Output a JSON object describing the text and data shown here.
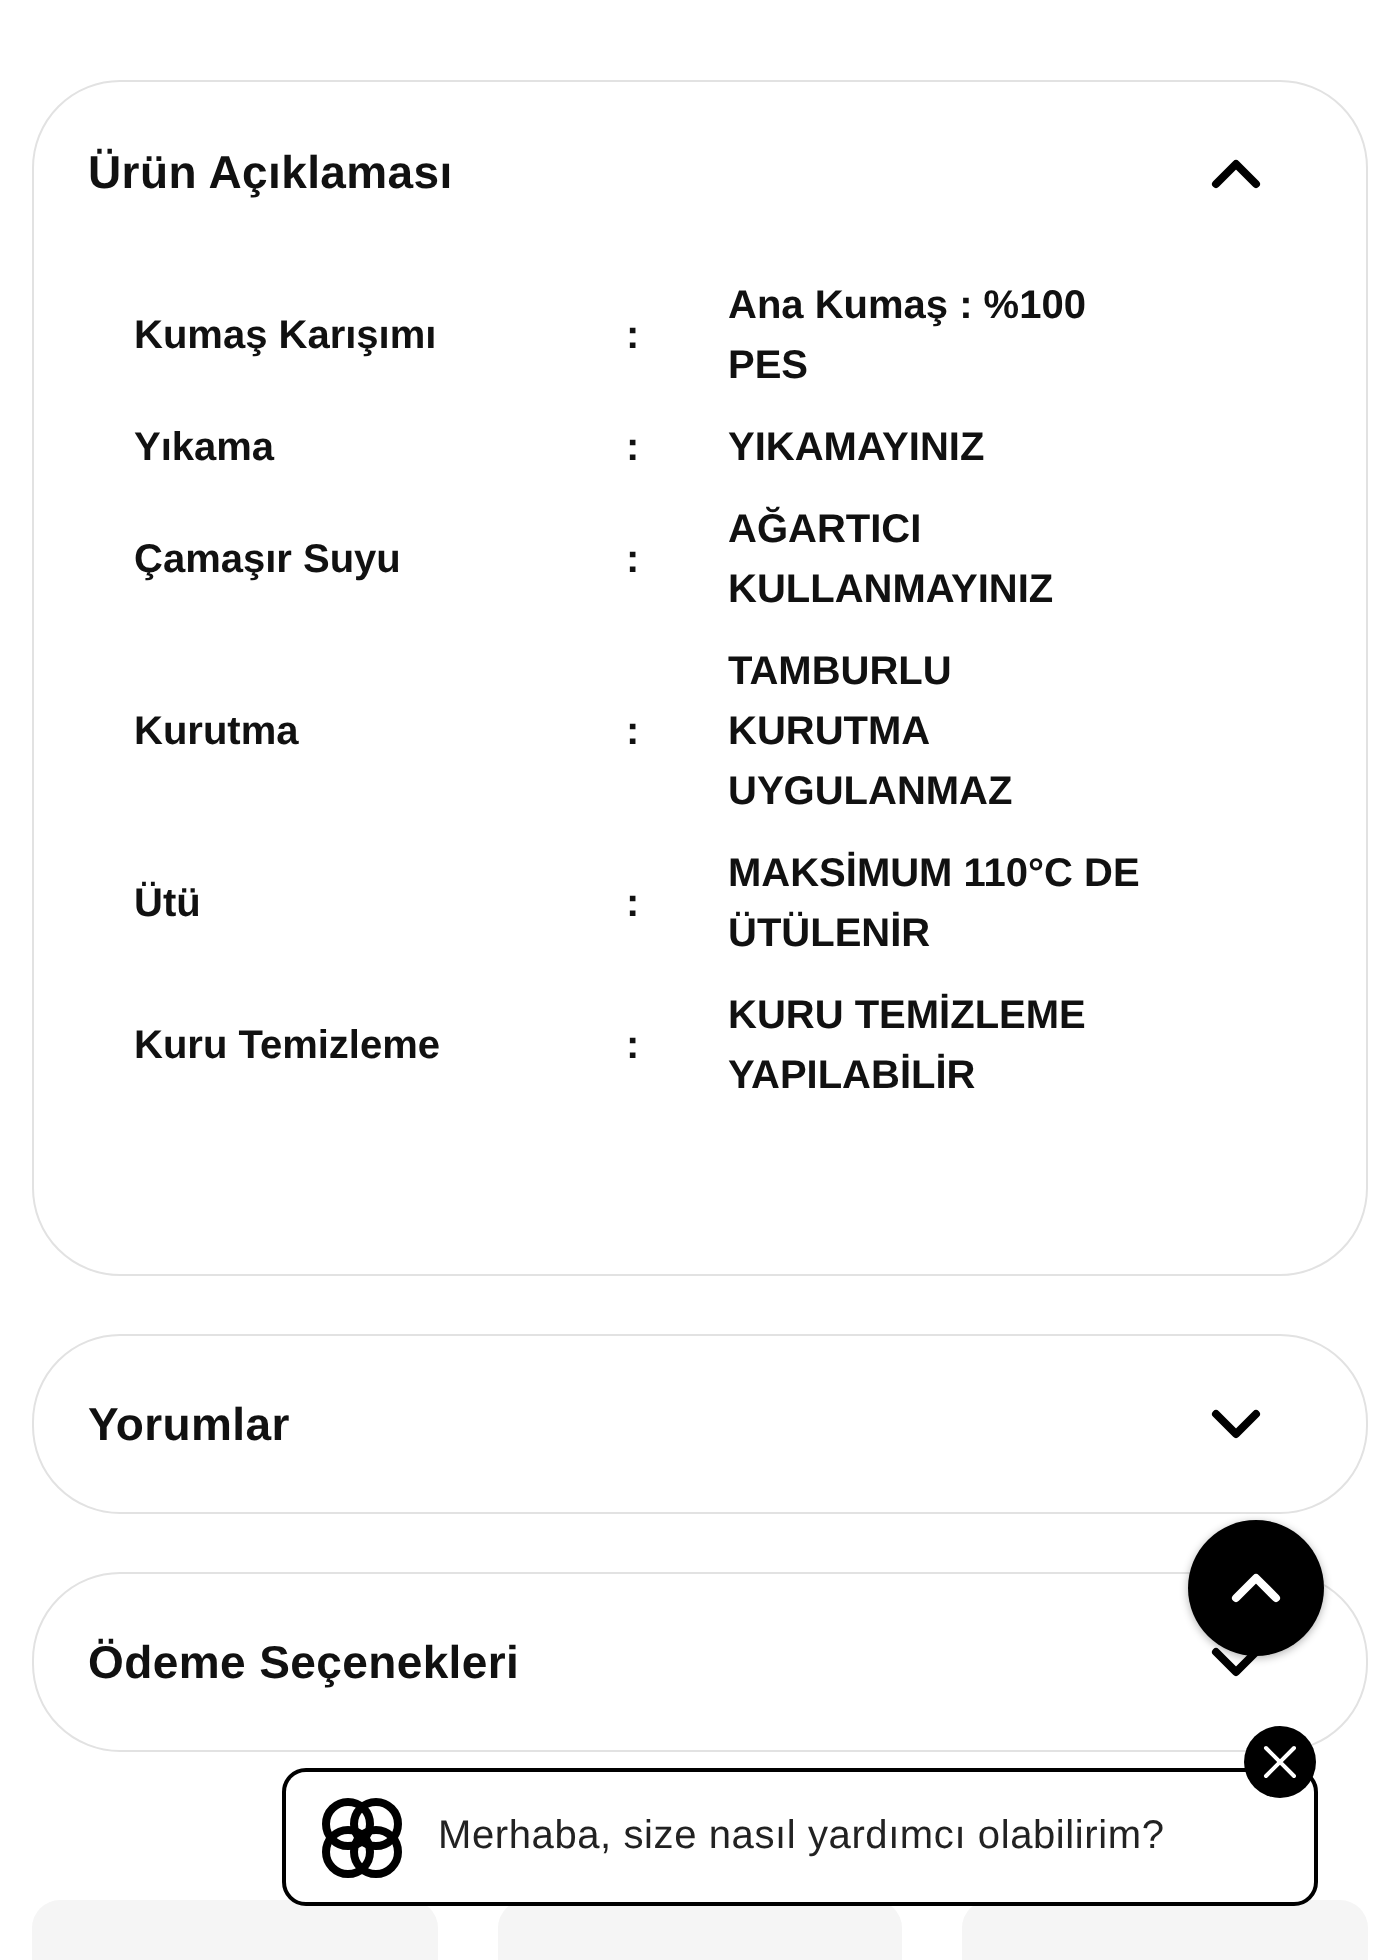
{
  "sections": [
    {
      "title": "Ürün Açıklaması",
      "expanded": true,
      "rows": [
        {
          "label": "Kumaş Karışımı",
          "separator": ":",
          "value": "Ana Kumaş : %100 PES"
        },
        {
          "label": "Yıkama",
          "separator": ":",
          "value": "YIKAMAYINIZ"
        },
        {
          "label": "Çamaşır Suyu",
          "separator": ":",
          "value": "AĞARTICI KULLANMAYINIZ"
        },
        {
          "label": "Kurutma",
          "separator": ":",
          "value": "TAMBURLU KURUTMA UYGULANMAZ"
        },
        {
          "label": "Ütü",
          "separator": ":",
          "value": "MAKSİMUM 110°C DE ÜTÜLENİR"
        },
        {
          "label": "Kuru Temizleme",
          "separator": ":",
          "value": "KURU TEMİZLEME YAPILABİLİR"
        }
      ]
    },
    {
      "title": "Yorumlar",
      "expanded": false
    },
    {
      "title": "Ödeme Seçenekleri",
      "expanded": false
    }
  ],
  "chat": {
    "message": "Merhaba, size nasıl yardımcı olabilirim?"
  }
}
